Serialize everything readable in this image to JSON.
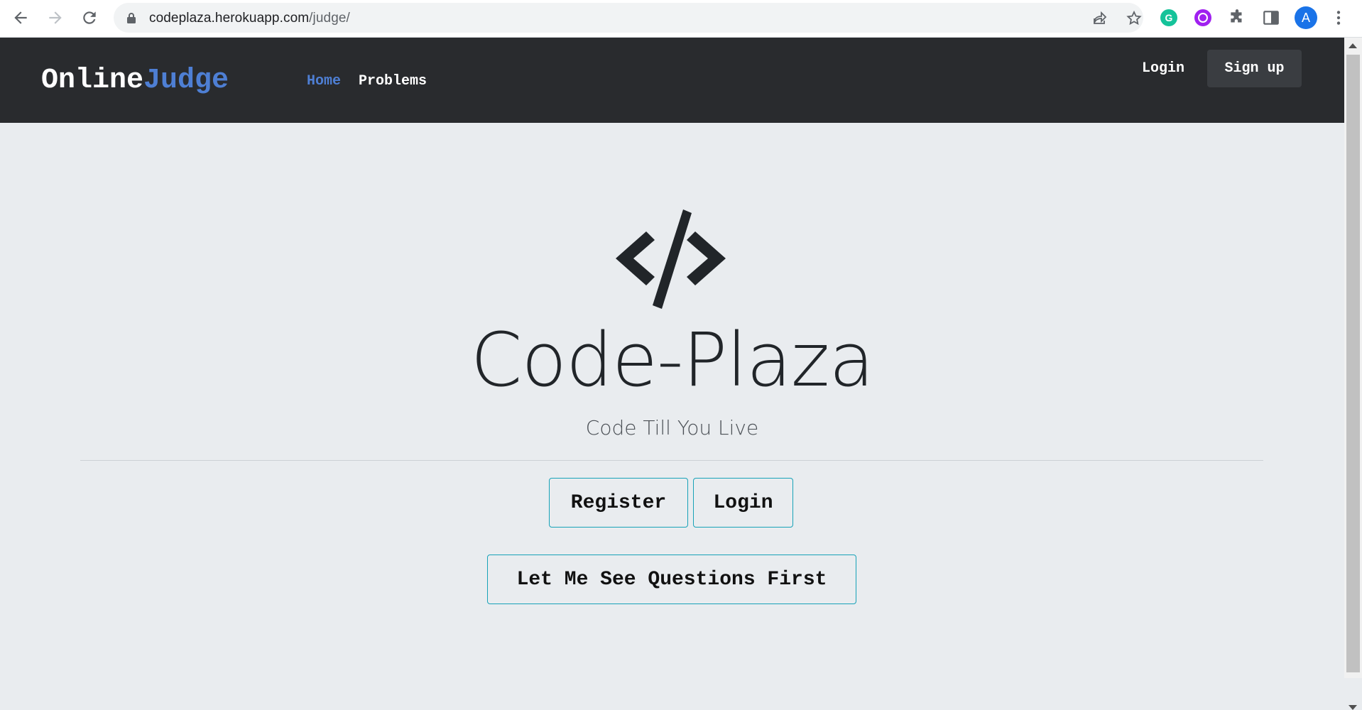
{
  "browser": {
    "url_host": "codeplaza.herokuapp.com",
    "url_path": "/judge/",
    "profile_initial": "A",
    "icons": [
      "back-arrow-icon",
      "forward-arrow-icon",
      "reload-icon",
      "lock-icon",
      "share-icon",
      "star-icon",
      "grammarly-icon",
      "extension-icon",
      "puzzle-icon",
      "side-panel-icon",
      "more-icon"
    ]
  },
  "navbar": {
    "brand_part1": "Online",
    "brand_part2": "Judge",
    "links": [
      {
        "label": "Home",
        "active": true
      },
      {
        "label": "Problems",
        "active": false
      }
    ],
    "login_label": "Login",
    "signup_label": "Sign up"
  },
  "hero": {
    "title": "Code-Plaza",
    "subtitle": "Code Till You Live",
    "register_label": "Register",
    "login_label": "Login",
    "questions_label": "Let Me See Questions First"
  },
  "colors": {
    "navbar_bg": "#292b2e",
    "accent": "#4e7fd4",
    "page_bg": "#e9ecef",
    "button_border": "#17a2b8"
  }
}
